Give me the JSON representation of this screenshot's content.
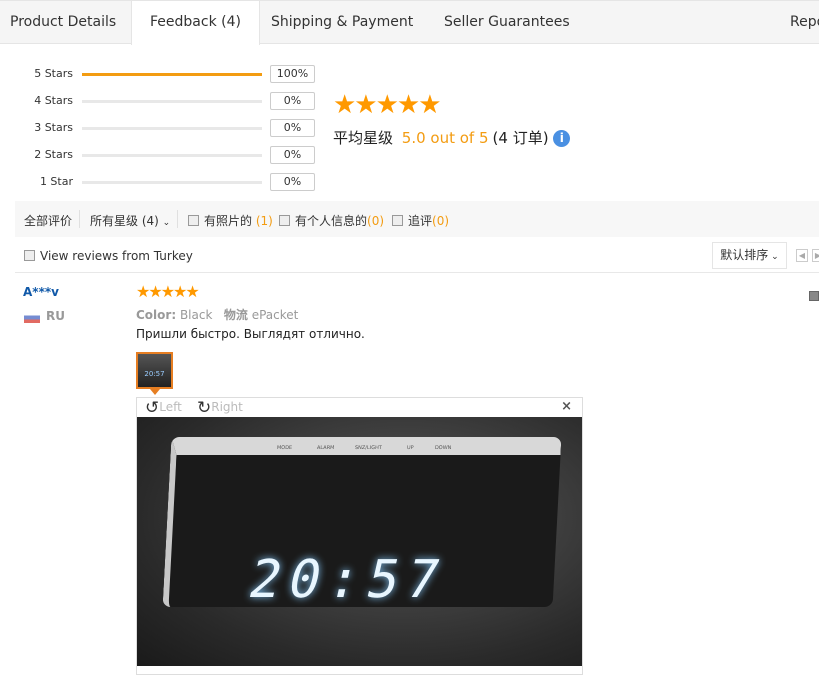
{
  "tabs": [
    {
      "label": "Product Details"
    },
    {
      "label": "Feedback (4)",
      "active": true
    },
    {
      "label": "Shipping & Payment"
    },
    {
      "label": "Seller Guarantees"
    },
    {
      "label": "Repo"
    }
  ],
  "ratings": [
    {
      "label": "5 Stars",
      "percent": 100,
      "text": "100%"
    },
    {
      "label": "4 Stars",
      "percent": 0,
      "text": "0%"
    },
    {
      "label": "3 Stars",
      "percent": 0,
      "text": "0%"
    },
    {
      "label": "2 Stars",
      "percent": 0,
      "text": "0%"
    },
    {
      "label": "1 Star",
      "percent": 0,
      "text": "0%"
    }
  ],
  "summary": {
    "stars": "★★★★★",
    "label": "平均星级",
    "score": "5.0 out of 5",
    "orders": "(4 订单)",
    "info": "i"
  },
  "filters": {
    "all": "全部评价",
    "stars_dropdown": "所有星级 (4)",
    "photo_label": "有照片的",
    "photo_count": "(1)",
    "info_label": "有个人信息的",
    "info_count": "(0)",
    "followup_label": "追评",
    "followup_count": "(0)"
  },
  "country_filter": "View reviews from Turkey",
  "sort": "默认排序",
  "review": {
    "user": "A***v",
    "country": "RU",
    "stars": "★★★★★",
    "color_label": "Color:",
    "color": "Black",
    "shipping_label": "物流",
    "shipping": "ePacket",
    "text": "Пришли быстро. Выглядят отлично.",
    "thumb_text": "20:57"
  },
  "viewer": {
    "rotate_left": "Left",
    "rotate_right": "Right",
    "close": "×",
    "clock_display": "20:57",
    "buttons": [
      "MODE",
      "ALARM",
      "SNZ/LIGHT",
      "UP",
      "DOWN"
    ]
  },
  "colors": {
    "accent": "#f39c12",
    "link": "#0f58a8"
  }
}
